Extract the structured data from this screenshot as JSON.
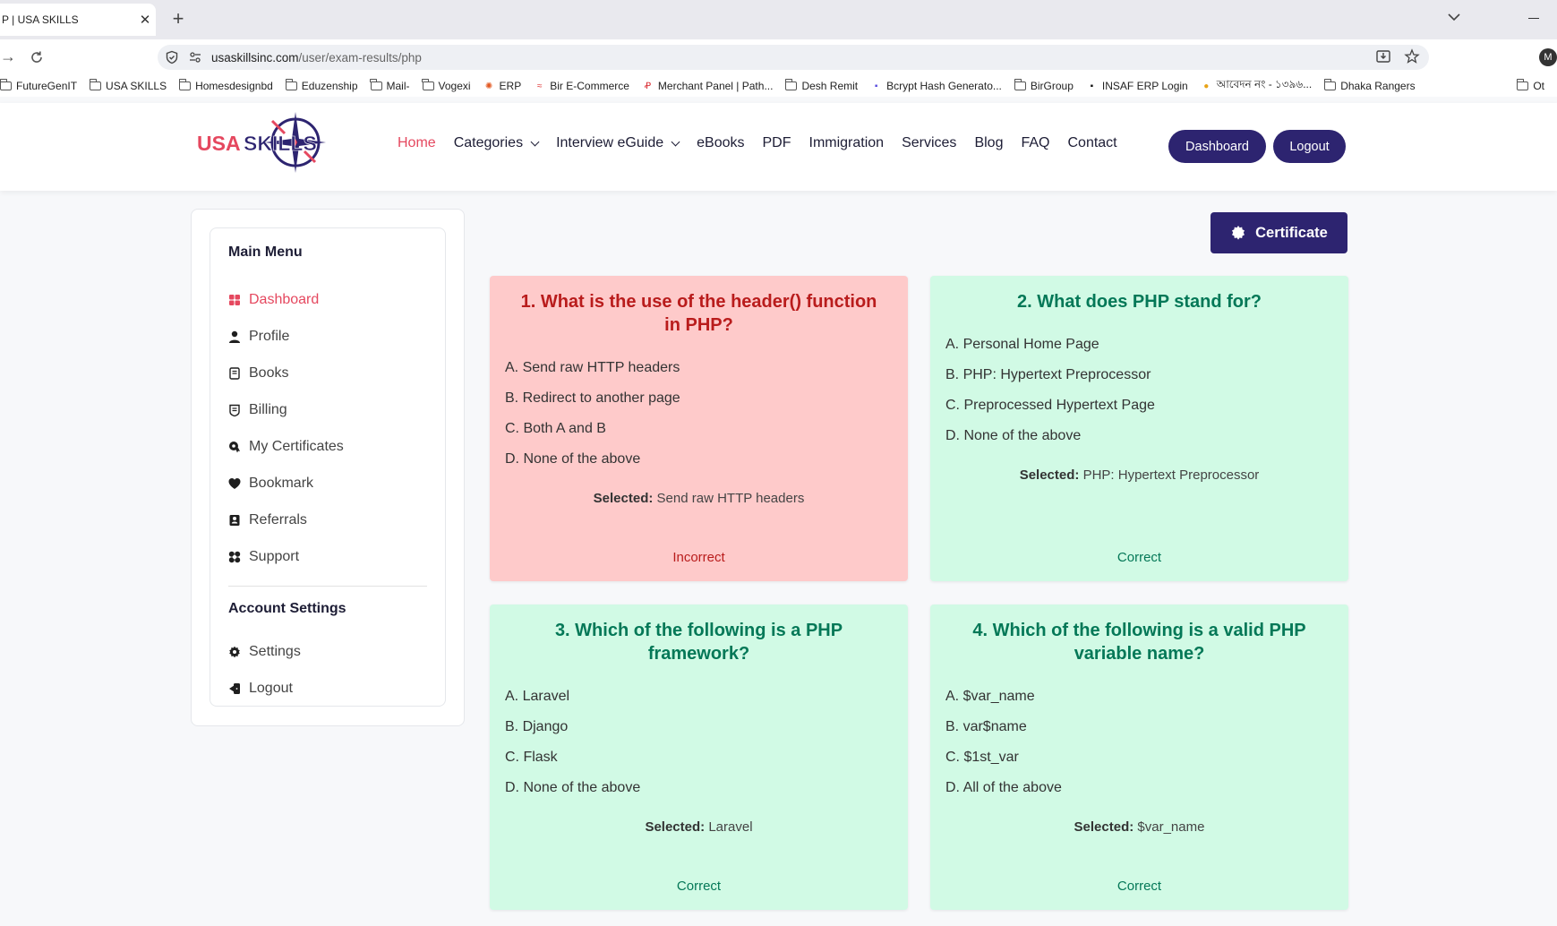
{
  "browser": {
    "tab_title": "P | USA SKILLS",
    "url_host": "usaskillsinc.com",
    "url_path": "/user/exam-results/php",
    "profile_initial": "M",
    "bookmarks": [
      {
        "label": "FutureGenIT",
        "type": "folder"
      },
      {
        "label": "USA SKILLS",
        "type": "folder"
      },
      {
        "label": "Homesdesignbd",
        "type": "folder"
      },
      {
        "label": "Eduzenship",
        "type": "folder"
      },
      {
        "label": "Mail-",
        "type": "folder"
      },
      {
        "label": "Vogexi",
        "type": "folder"
      },
      {
        "label": "ERP",
        "type": "site",
        "color": "#e25822",
        "glyph": "✺"
      },
      {
        "label": "Bir E-Commerce",
        "type": "site",
        "color": "#e03a3a",
        "glyph": "≈"
      },
      {
        "label": "Merchant Panel | Path...",
        "type": "site",
        "color": "#d8242a",
        "glyph": "Ꝓ"
      },
      {
        "label": "Desh Remit",
        "type": "folder"
      },
      {
        "label": "Bcrypt Hash Generato...",
        "type": "site",
        "color": "#5b4ee0",
        "glyph": "▪"
      },
      {
        "label": "BirGroup",
        "type": "folder"
      },
      {
        "label": "INSAF ERP Login",
        "type": "site",
        "color": "#111111",
        "glyph": "▪"
      },
      {
        "label": "আবেদন নং - ১৩৯৬...",
        "type": "site",
        "color": "#e8a317",
        "glyph": "●"
      },
      {
        "label": "Dhaka Rangers",
        "type": "folder"
      }
    ],
    "bookmark_overflow": "Ot"
  },
  "header": {
    "logo_text_usa": "USA",
    "logo_text_skills": "SKILLS",
    "nav": [
      {
        "label": "Home",
        "active": true,
        "dropdown": false
      },
      {
        "label": "Categories",
        "active": false,
        "dropdown": true
      },
      {
        "label": "Interview eGuide",
        "active": false,
        "dropdown": true
      },
      {
        "label": "eBooks",
        "active": false,
        "dropdown": false
      },
      {
        "label": "PDF",
        "active": false,
        "dropdown": false
      },
      {
        "label": "Immigration",
        "active": false,
        "dropdown": false
      },
      {
        "label": "Services",
        "active": false,
        "dropdown": false
      },
      {
        "label": "Blog",
        "active": false,
        "dropdown": false
      },
      {
        "label": "FAQ",
        "active": false,
        "dropdown": false
      },
      {
        "label": "Contact",
        "active": false,
        "dropdown": false
      }
    ],
    "dashboard_label": "Dashboard",
    "logout_label": "Logout"
  },
  "sidebar": {
    "main_heading": "Main Menu",
    "main_items": [
      {
        "label": "Dashboard",
        "icon": "dashboard-icon",
        "active": true
      },
      {
        "label": "Profile",
        "icon": "user-icon",
        "active": false
      },
      {
        "label": "Books",
        "icon": "book-icon",
        "active": false
      },
      {
        "label": "Billing",
        "icon": "billing-icon",
        "active": false
      },
      {
        "label": "My Certificates",
        "icon": "certificate-icon",
        "active": false
      },
      {
        "label": "Bookmark",
        "icon": "heart-icon",
        "active": false
      },
      {
        "label": "Referrals",
        "icon": "referral-icon",
        "active": false
      },
      {
        "label": "Support",
        "icon": "support-icon",
        "active": false
      }
    ],
    "account_heading": "Account Settings",
    "account_items": [
      {
        "label": "Settings",
        "icon": "gear-icon"
      },
      {
        "label": "Logout",
        "icon": "logout-icon"
      }
    ]
  },
  "certificate_label": "Certificate",
  "colors": {
    "brand": "#2d2470",
    "accent": "#e5485f",
    "incorrect_bg": "#fecaca",
    "incorrect_text": "#b91c1c",
    "correct_bg": "#d1fae5",
    "correct_text": "#047857"
  },
  "selected_prefix": "Selected:",
  "questions": [
    {
      "title": "1. What is the use of the header() function in PHP?",
      "options": [
        "A. Send raw HTTP headers",
        "B. Redirect to another page",
        "C. Both A and B",
        "D. None of the above"
      ],
      "selected": "Send raw HTTP headers",
      "result": "Incorrect",
      "correct": false
    },
    {
      "title": "2. What does PHP stand for?",
      "options": [
        "A. Personal Home Page",
        "B. PHP: Hypertext Preprocessor",
        "C. Preprocessed Hypertext Page",
        "D. None of the above"
      ],
      "selected": "PHP: Hypertext Preprocessor",
      "result": "Correct",
      "correct": true
    },
    {
      "title": "3. Which of the following is a PHP framework?",
      "options": [
        "A. Laravel",
        "B. Django",
        "C. Flask",
        "D. None of the above"
      ],
      "selected": "Laravel",
      "result": "Correct",
      "correct": true
    },
    {
      "title": "4. Which of the following is a valid PHP variable name?",
      "options": [
        "A. $var_name",
        "B. var$name",
        "C. $1st_var",
        "D. All of the above"
      ],
      "selected": "$var_name",
      "result": "Correct",
      "correct": true
    }
  ]
}
